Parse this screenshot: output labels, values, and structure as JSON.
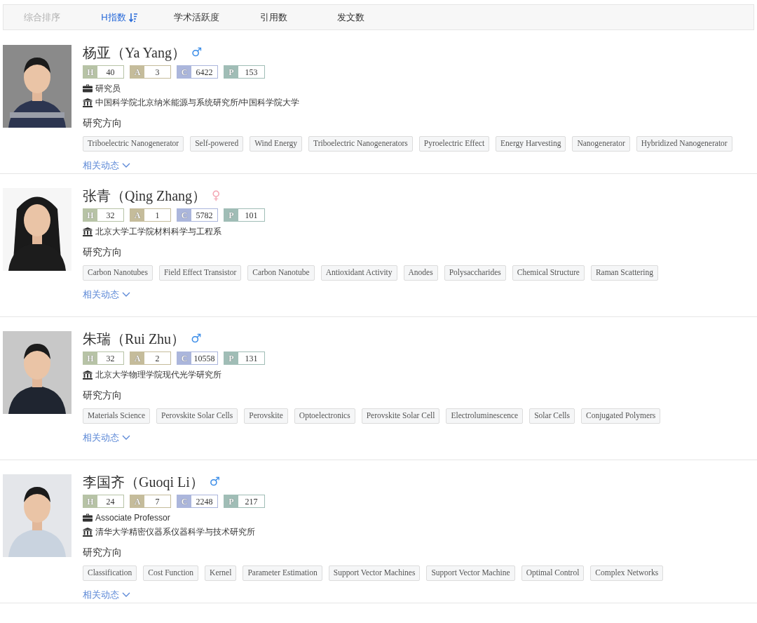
{
  "sort_tabs": [
    {
      "label": "综合排序",
      "selected": false,
      "disabled": true
    },
    {
      "label": "H指数",
      "selected": true,
      "disabled": false
    },
    {
      "label": "学术活跃度",
      "selected": false,
      "disabled": false
    },
    {
      "label": "引用数",
      "selected": false,
      "disabled": false
    },
    {
      "label": "发文数",
      "selected": false,
      "disabled": false
    }
  ],
  "scholars": [
    {
      "photo": {
        "kind": "picture"
      },
      "name": "杨亚（Ya Yang）",
      "gender": {
        "kind": "male",
        "symbol": "♂"
      },
      "stats": [
        {
          "letter": "H",
          "value": "40",
          "color": "#b7c3a6"
        },
        {
          "letter": "A",
          "value": "3",
          "color": "#c5bc9b"
        },
        {
          "letter": "C",
          "value": "6422",
          "color": "#abb6dc"
        },
        {
          "letter": "P",
          "value": "153",
          "color": "#a0bdb6"
        }
      ],
      "position": "研究员",
      "affiliation": "中国科学院北京纳米能源与系统研究所/中国科学院大学",
      "interests_label": "研究方向",
      "tags": [
        "Triboelectric Nanogenerator",
        "Self-powered",
        "Wind Energy",
        "Triboelectric Nanogenerators",
        "Pyroelectric Effect",
        "Energy Harvesting",
        "Nanogenerator",
        "Hybridized Nanogenerator"
      ],
      "more_link": "相关动态"
    },
    {
      "photo": {
        "kind": "picture"
      },
      "name": "张青（Qing Zhang）",
      "gender": {
        "kind": "female",
        "symbol": "♀"
      },
      "stats": [
        {
          "letter": "H",
          "value": "32",
          "color": "#b7c3a6"
        },
        {
          "letter": "A",
          "value": "1",
          "color": "#c5bc9b"
        },
        {
          "letter": "C",
          "value": "5782",
          "color": "#abb6dc"
        },
        {
          "letter": "P",
          "value": "101",
          "color": "#a0bdb6"
        }
      ],
      "affiliation": "北京大学工学院材料科学与工程系",
      "interests_label": "研究方向",
      "tags": [
        "Carbon Nanotubes",
        "Field Effect Transistor",
        "Carbon Nanotube",
        "Antioxidant Activity",
        "Anodes",
        "Polysaccharides",
        "Chemical Structure",
        "Raman Scattering"
      ],
      "more_link": "相关动态"
    },
    {
      "photo": {
        "kind": "picture"
      },
      "name": "朱瑞（Rui Zhu）",
      "gender": {
        "kind": "male",
        "symbol": "♂"
      },
      "stats": [
        {
          "letter": "H",
          "value": "32",
          "color": "#b7c3a6"
        },
        {
          "letter": "A",
          "value": "2",
          "color": "#c5bc9b"
        },
        {
          "letter": "C",
          "value": "10558",
          "color": "#abb6dc"
        },
        {
          "letter": "P",
          "value": "131",
          "color": "#a0bdb6"
        }
      ],
      "affiliation": "北京大学物理学院现代光学研究所",
      "interests_label": "研究方向",
      "tags": [
        "Materials Science",
        "Perovskite Solar Cells",
        "Perovskite",
        "Optoelectronics",
        "Perovskite Solar Cell",
        "Electroluminescence",
        "Solar Cells",
        "Conjugated Polymers"
      ],
      "more_link": "相关动态"
    },
    {
      "photo": {
        "kind": "picture"
      },
      "name": "李国齐（Guoqi Li）",
      "gender": {
        "kind": "male",
        "symbol": "♂"
      },
      "stats": [
        {
          "letter": "H",
          "value": "24",
          "color": "#b7c3a6"
        },
        {
          "letter": "A",
          "value": "7",
          "color": "#c5bc9b"
        },
        {
          "letter": "C",
          "value": "2248",
          "color": "#abb6dc"
        },
        {
          "letter": "P",
          "value": "217",
          "color": "#a0bdb6"
        }
      ],
      "position": "Associate Professor",
      "affiliation": "清华大学精密仪器系仪器科学与技术研究所",
      "interests_label": "研究方向",
      "tags": [
        "Classification",
        "Cost Function",
        "Kernel",
        "Parameter Estimation",
        "Support Vector Machines",
        "Support Vector Machine",
        "Optimal Control",
        "Complex Networks"
      ],
      "more_link": "相关动态"
    }
  ]
}
